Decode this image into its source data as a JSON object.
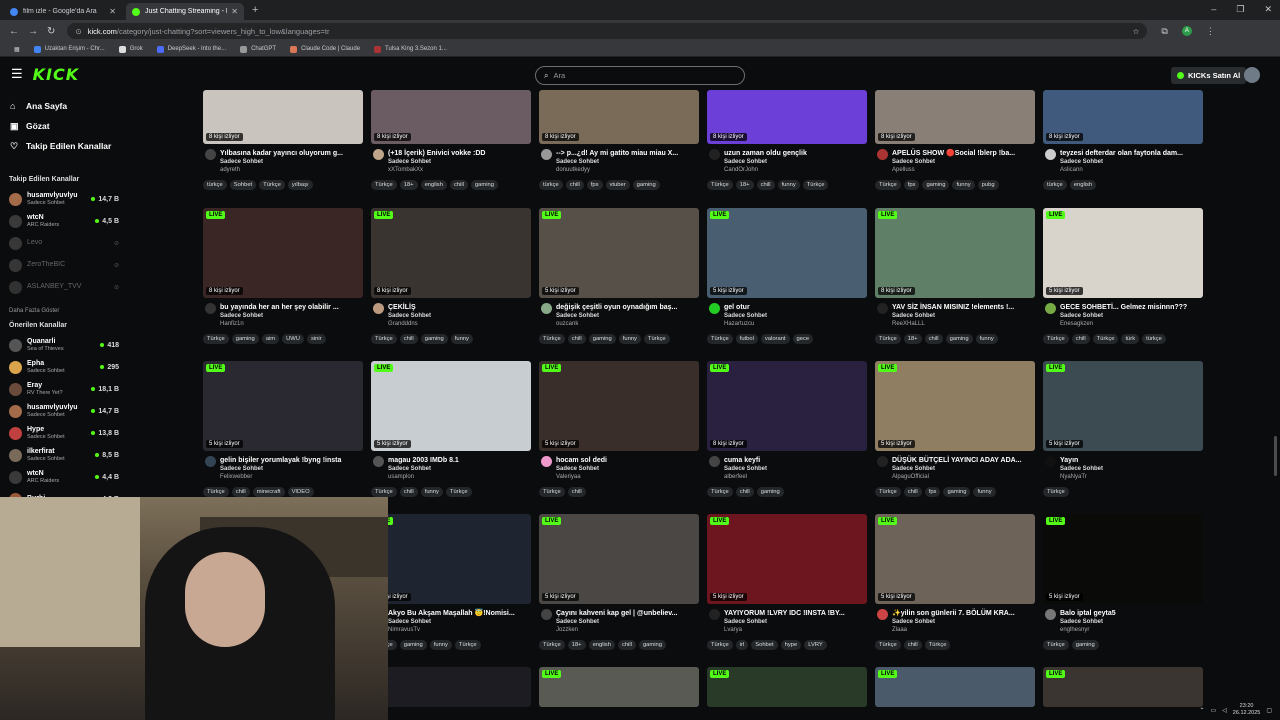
{
  "browser": {
    "tabs": [
      {
        "title": "film izle - Google'da Ara",
        "color": "#4285f4",
        "active": false
      },
      {
        "title": "Just Chatting Streaming - Livi",
        "color": "#53fc18",
        "active": true
      }
    ],
    "url": "kick.com/category/just-chatting?sort=viewers_high_to_low&languages=tr",
    "url_host": "kick.com",
    "url_path": "/category/just-chatting?sort=viewers_high_to_low&languages=tr",
    "bookmarks": [
      "Uzaktan Erişim - Chr...",
      "Grok",
      "DeepSeek - Into the...",
      "ChatGPT",
      "Claude Code | Claude",
      "Tulsa King 3.Sezon 1..."
    ]
  },
  "header": {
    "logo": "KICK",
    "search_placeholder": "Ara",
    "buy_label": "KICKs Satın Al"
  },
  "sidebar": {
    "nav": [
      {
        "label": "Ana Sayfa",
        "icon": "home-icon"
      },
      {
        "label": "Gözat",
        "icon": "browse-icon"
      },
      {
        "label": "Takip Edilen Kanallar",
        "icon": "heart-icon"
      }
    ],
    "followed_title": "Takip Edilen Kanallar",
    "followed": [
      {
        "name": "husamvlyuvlyu",
        "category": "Sadece Sohbet",
        "viewers": "14,7 B",
        "online": true,
        "color": "#a46b4b"
      },
      {
        "name": "wtcN",
        "category": "ARC Raiders",
        "viewers": "4,5 B",
        "online": true,
        "color": "#3a3a3a"
      },
      {
        "name": "Levo",
        "category": "",
        "viewers": "",
        "online": false,
        "color": "#8a8a8a"
      },
      {
        "name": "ZeroTheBIC",
        "category": "",
        "viewers": "",
        "online": false,
        "color": "#888"
      },
      {
        "name": "ASLANBEY_TVV",
        "category": "",
        "viewers": "",
        "online": false,
        "color": "#777"
      }
    ],
    "more_label": "Daha Fazla Göster",
    "suggested_title": "Önerilen Kanallar",
    "suggested": [
      {
        "name": "Quanarli",
        "category": "Sea of Thieves",
        "viewers": "418",
        "color": "#555"
      },
      {
        "name": "Epha",
        "category": "Sadece Sohbet",
        "viewers": "295",
        "color": "#d9a44c"
      },
      {
        "name": "Eray",
        "category": "RV There Yet?",
        "viewers": "18,1 B",
        "color": "#6a4a3a"
      },
      {
        "name": "husamvlyuvlyu",
        "category": "Sadece Sohbet",
        "viewers": "14,7 B",
        "color": "#a46b4b"
      },
      {
        "name": "Hype",
        "category": "Sadece Sohbet",
        "viewers": "13,8 B",
        "color": "#c04040"
      },
      {
        "name": "ilkerfirat",
        "category": "Sadece Sohbet",
        "viewers": "8,5 B",
        "color": "#7a6a5a"
      },
      {
        "name": "wtcN",
        "category": "ARC Raiders",
        "viewers": "4,4 B",
        "color": "#3a3a3a"
      },
      {
        "name": "Burhi",
        "category": "",
        "viewers": "4,2 B",
        "color": "#9a5a3a"
      }
    ]
  },
  "rows": [
    [
      {
        "live": "",
        "viewers": "8 kişi izliyor",
        "title": "Yılbasına kadar yayıncı oluyorum g...",
        "category": "Sadece Sohbet",
        "channel": "adyreth",
        "tags": [
          "türkçe",
          "Sohbet",
          "Türkçe",
          "yılbaşı"
        ],
        "thumb": "#c9c4bd",
        "avatar": "#444"
      },
      {
        "live": "",
        "viewers": "8 kişi izliyor",
        "title": "(+18 İçerik) Enivici vokke :DD",
        "category": "Sadece Sohbet",
        "channel": "xXTombakXx",
        "tags": [
          "Türkçe",
          "18+",
          "english",
          "chill",
          "gaming"
        ],
        "thumb": "#6b5c63",
        "avatar": "#bfa58a"
      },
      {
        "live": "",
        "viewers": "8 kişi izliyor",
        "title": "--> p...¿d! Ay mi gatito miau miau X...",
        "category": "Sadece Sohbet",
        "channel": "donuutkedyy",
        "tags": [
          "türkçe",
          "chill",
          "fps",
          "vtuber",
          "gaming"
        ],
        "thumb": "#7a6a58",
        "avatar": "#999"
      },
      {
        "live": "",
        "viewers": "8 kişi izliyor",
        "title": "uzun zaman oldu gençlik",
        "category": "Sadece Sohbet",
        "channel": "CandOrJohn",
        "tags": [
          "Türkçe",
          "18+",
          "chill",
          "funny",
          "Türkçe"
        ],
        "thumb": "#6b3fd8",
        "avatar": "#222"
      },
      {
        "live": "",
        "viewers": "8 kişi izliyor",
        "title": "APELÜS SHOW 🔴Social !blerp !ba...",
        "category": "Sadece Sohbet",
        "channel": "Apelluss",
        "tags": [
          "Türkçe",
          "fps",
          "gaming",
          "funny",
          "pubg"
        ],
        "thumb": "#8a7f76",
        "avatar": "#a33"
      },
      {
        "live": "",
        "viewers": "8 kişi izliyor",
        "title": "teyzesi defterdar olan faytonla dam...",
        "category": "Sadece Sohbet",
        "channel": "Aslicann",
        "tags": [
          "türkçe",
          "english"
        ],
        "thumb": "#3f5a7d",
        "avatar": "#ccc"
      }
    ],
    [
      {
        "live": "LIVE",
        "viewers": "8 kişi izliyor",
        "title": "bu yayında her an her şey olabilir ...",
        "category": "Sadece Sohbet",
        "channel": "Hanfiz1n",
        "tags": [
          "Türkçe",
          "gaming",
          "aim",
          "UWU",
          "sinir"
        ],
        "thumb": "#3b2626",
        "avatar": "#333"
      },
      {
        "live": "LIVE",
        "viewers": "8 kişi izliyor",
        "title": "ÇEKİLİŞ",
        "category": "Sadece Sohbet",
        "channel": "Grandddns",
        "tags": [
          "Türkçe",
          "chill",
          "gaming",
          "funny"
        ],
        "thumb": "#3a3431",
        "avatar": "#bb9a80"
      },
      {
        "live": "LIVE",
        "viewers": "5 kişi izliyor",
        "title": "değişik çeşitli oyun oynadığım baş...",
        "category": "Sadece Sohbet",
        "channel": "ouzcank",
        "tags": [
          "Türkçe",
          "chill",
          "gaming",
          "funny",
          "Türkçe"
        ],
        "thumb": "#565049",
        "avatar": "#8a8"
      },
      {
        "live": "LIVE",
        "viewers": "5 kişi izliyor",
        "title": "gel otur",
        "category": "Sadece Sohbet",
        "channel": "Hazartuzcu",
        "tags": [
          "Türkçe",
          "futbol",
          "valorant",
          "gece"
        ],
        "thumb": "#4a5e72",
        "avatar": "#2c2"
      },
      {
        "live": "LIVE",
        "viewers": "8 kişi izliyor",
        "title": "YAV SİZ İNSAN MISINIZ !elements !...",
        "category": "Sadece Sohbet",
        "channel": "ReeXHaLLL",
        "tags": [
          "Türkçe",
          "18+",
          "chill",
          "gaming",
          "funny"
        ],
        "thumb": "#5f7f66",
        "avatar": "#222"
      },
      {
        "live": "LIVE",
        "viewers": "5 kişi izliyor",
        "title": "GECE SOHBETİ... Gelmez misinnn???",
        "category": "Sadece Sohbet",
        "channel": "Enesagkzen",
        "tags": [
          "Türkçe",
          "chill",
          "Türkçe",
          "türk",
          "türkçe"
        ],
        "thumb": "#d8d4cc",
        "avatar": "#7a4"
      }
    ],
    [
      {
        "live": "LIVE",
        "viewers": "5 kişi izliyor",
        "title": "gelin bişiler yorumlayak !byng !insta",
        "category": "Sadece Sohbet",
        "channel": "Felixwebber",
        "tags": [
          "Türkçe",
          "chill",
          "minecraft",
          "VIDEO"
        ],
        "thumb": "#2a2830",
        "avatar": "#345"
      },
      {
        "live": "LIVE",
        "viewers": "5 kişi izliyor",
        "title": "magau 2003 IMDb 8.1",
        "category": "Sadece Sohbet",
        "channel": "usamplon",
        "tags": [
          "Türkçe",
          "chill",
          "funny",
          "Türkçe"
        ],
        "thumb": "#c8cdd2",
        "avatar": "#555"
      },
      {
        "live": "LIVE",
        "viewers": "5 kişi izliyor",
        "title": "hocam sol dedi",
        "category": "Sadece Sohbet",
        "channel": "Valeriyaa",
        "tags": [
          "Türkçe",
          "chill"
        ],
        "thumb": "#3a2e2a",
        "avatar": "#e9c"
      },
      {
        "live": "LIVE",
        "viewers": "8 kişi izliyor",
        "title": "cuma keyfi",
        "category": "Sadece Sohbet",
        "channel": "alberfeel",
        "tags": [
          "Türkçe",
          "chill",
          "gaming"
        ],
        "thumb": "#2a2040",
        "avatar": "#444"
      },
      {
        "live": "LIVE",
        "viewers": "5 kişi izliyor",
        "title": "DÜŞÜK BÜTÇELİ YAYINCI ADAY ADA...",
        "category": "Sadece Sohbet",
        "channel": "AlpaguOfficial",
        "tags": [
          "Türkçe",
          "chill",
          "fps",
          "gaming",
          "funny"
        ],
        "thumb": "#8f7e62",
        "avatar": "#222"
      },
      {
        "live": "LIVE",
        "viewers": "5 kişi izliyor",
        "title": "Yayın",
        "category": "Sadece Sohbet",
        "channel": "NyaNyaTr",
        "tags": [
          "Türkçe"
        ],
        "thumb": "#3c4a52",
        "avatar": "#111"
      }
    ],
    [
      {
        "live": "",
        "viewers": "",
        "title": "",
        "category": "",
        "channel": "",
        "tags": [],
        "thumb": "#1a1a1a",
        "avatar": "#000"
      },
      {
        "live": "LIVE",
        "viewers": "5 kişi izliyor",
        "title": "Akyo Bu Akşam Maşallah 😇!Nomisi...",
        "category": "Sadece Sohbet",
        "channel": "NimravusTv",
        "tags": [
          "Türkçe",
          "gaming",
          "funny",
          "Türkçe"
        ],
        "thumb": "#1e2430",
        "avatar": "#333"
      },
      {
        "live": "LIVE",
        "viewers": "5 kişi izliyor",
        "title": "Çayını kahveni kap gel | @unbeliev...",
        "category": "Sadece Sohbet",
        "channel": "Jozzken",
        "tags": [
          "Türkçe",
          "18+",
          "english",
          "chill",
          "gaming"
        ],
        "thumb": "#4a4744",
        "avatar": "#444"
      },
      {
        "live": "LIVE",
        "viewers": "5 kişi izliyor",
        "title": "YAYIYORUM !LVRY IDC !INSTA !BY...",
        "category": "Sadece Sohbet",
        "channel": "Lvarya",
        "tags": [
          "Türkçe",
          "irl",
          "Sohbet",
          "hype",
          "LVRY"
        ],
        "thumb": "#6e1620",
        "avatar": "#222"
      },
      {
        "live": "LIVE",
        "viewers": "5 kişi izliyor",
        "title": "✨yilin son günlerii 7. BÖLÜM KRA...",
        "category": "Sadece Sohbet",
        "channel": "Zlaaa",
        "tags": [
          "Türkçe",
          "chill",
          "Türkçe"
        ],
        "thumb": "#6d6358",
        "avatar": "#c44"
      },
      {
        "live": "LIVE",
        "viewers": "5 kişi izliyor",
        "title": "Balo iptal geyta5",
        "category": "Sadece Sohbet",
        "channel": "englhesnyr",
        "tags": [
          "Türkçe",
          "gaming"
        ],
        "thumb": "#0a0a08",
        "avatar": "#777"
      }
    ],
    [
      {
        "live": "",
        "viewers": "",
        "title": "",
        "category": "",
        "channel": "",
        "tags": [],
        "thumb": "#1a1a1a",
        "avatar": "#000"
      },
      {
        "live": "",
        "viewers": "",
        "title": "",
        "category": "",
        "channel": "",
        "tags": [],
        "thumb": "#1c1c22",
        "avatar": "#000"
      },
      {
        "live": "LIVE",
        "viewers": "",
        "title": "",
        "category": "",
        "channel": "",
        "tags": [],
        "thumb": "#5a5a55",
        "avatar": "#000"
      },
      {
        "live": "LIVE",
        "viewers": "",
        "title": "",
        "category": "",
        "channel": "",
        "tags": [],
        "thumb": "#2a3a28",
        "avatar": "#000"
      },
      {
        "live": "LIVE",
        "viewers": "",
        "title": "",
        "category": "",
        "channel": "",
        "tags": [],
        "thumb": "#4a5a6a",
        "avatar": "#000"
      },
      {
        "live": "LIVE",
        "viewers": "",
        "title": "",
        "category": "",
        "channel": "",
        "tags": [],
        "thumb": "#3a3530",
        "avatar": "#000"
      }
    ]
  ],
  "taskbar": {
    "time": "23:20",
    "date": "26.12.2025"
  }
}
